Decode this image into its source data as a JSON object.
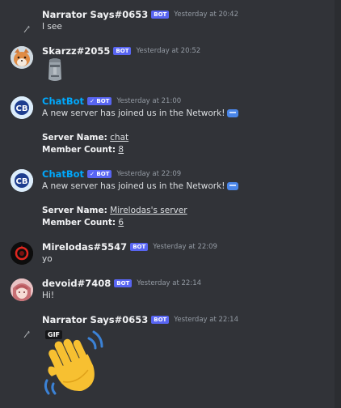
{
  "messages": [
    {
      "username": "Narrator Says#0653",
      "badge": "BOT",
      "timestamp": "Yesterday at 20:42",
      "text": "I see"
    },
    {
      "username": "Skarzz#2055",
      "badge": "BOT",
      "timestamp": "Yesterday at 20:52",
      "emoji": "moai-emoji"
    },
    {
      "username": "ChatBot",
      "badge": "✓ BOT",
      "timestamp": "Yesterday at 21:00",
      "text": "A new server has joined us in the Network!",
      "server_label": "Server Name:",
      "server_value": "chat",
      "count_label": "Member Count:",
      "count_value": "8"
    },
    {
      "username": "ChatBot",
      "badge": "✓ BOT",
      "timestamp": "Yesterday at 22:09",
      "text": "A new server has joined us in the Network!",
      "server_label": "Server Name:",
      "server_value": "Mirelodas's server",
      "count_label": "Member Count:",
      "count_value": "6"
    },
    {
      "username": "Mirelodas#5547",
      "badge": "BOT",
      "timestamp": "Yesterday at 22:09",
      "text": "yo"
    },
    {
      "username": "devoid#7408",
      "badge": "BOT",
      "timestamp": "Yesterday at 22:14",
      "text": "Hi!"
    },
    {
      "username": "Narrator Says#0653",
      "badge": "BOT",
      "timestamp": "Yesterday at 22:14",
      "gif_label": "GIF",
      "gif": "waving-hand-gif"
    }
  ],
  "colors": {
    "background": "#313338",
    "bot_badge": "#5865f2",
    "chatbot_name": "#00a8fc"
  }
}
